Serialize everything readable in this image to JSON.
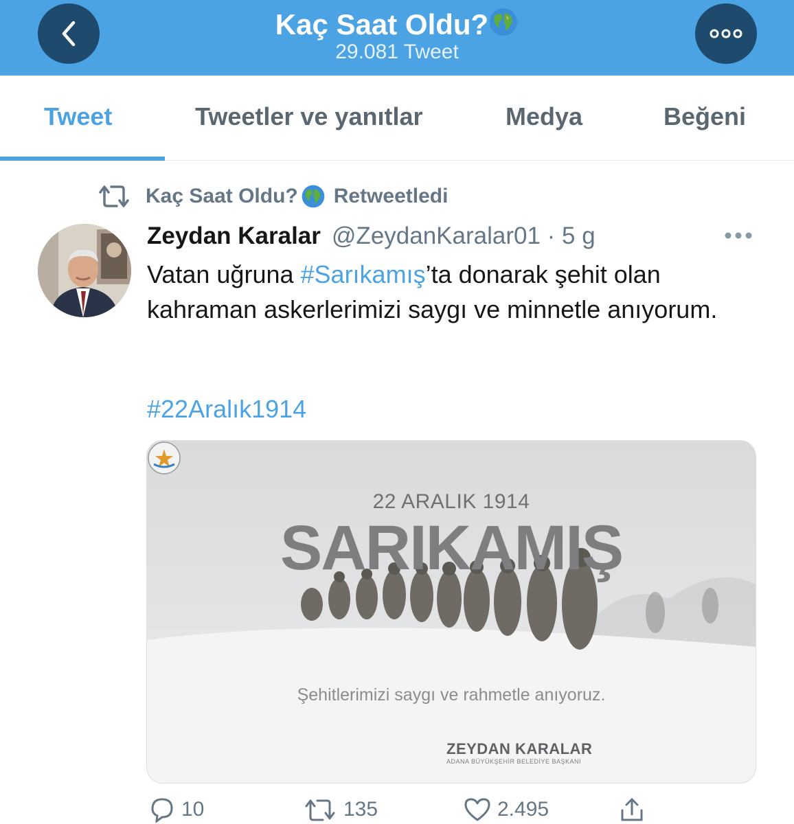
{
  "header": {
    "title": "Kaç Saat Oldu?",
    "title_icon": "globe-icon",
    "subtitle": "29.081 Tweet",
    "background": "#4ba3e3",
    "back_icon": "chevron-left-icon",
    "more_icon": "more-horizontal-icon"
  },
  "tabs": [
    {
      "label": "Tweet",
      "active": true
    },
    {
      "label": "Tweetler ve yanıtlar",
      "active": false
    },
    {
      "label": "Medya",
      "active": false
    },
    {
      "label": "Beğeni",
      "active": false
    }
  ],
  "retweet": {
    "icon": "retweet-icon",
    "by": "Kaç Saat Oldu?",
    "label": "Retweetledi"
  },
  "tweet": {
    "author_name": "Zeydan Karalar",
    "author_handle": "@ZeydanKaralar01 · 5 g",
    "text_before": "Vatan uğruna ",
    "hashtag_1": "#Sarıkamış",
    "text_after": "’ta donarak şehit olan kahraman askerlerimizi saygı ve minnetle anıyorum.",
    "hashtag_2": "#22Aralık1914",
    "media": {
      "date": "22 ARALIK 1914",
      "headline": "SARIKAMIŞ",
      "caption": "Şehitlerimizi saygı ve rahmetle anıyoruz.",
      "org_name": "ZEYDAN KARALAR",
      "org_sub": "ADANA BÜYÜKŞEHİR BELEDİYE BAŞKANI"
    },
    "actions": {
      "replies": "10",
      "retweets": "135",
      "likes": "2.495"
    }
  },
  "colors": {
    "accent": "#4ba3e3",
    "header_button": "#1e4a6e",
    "muted": "#657786"
  }
}
